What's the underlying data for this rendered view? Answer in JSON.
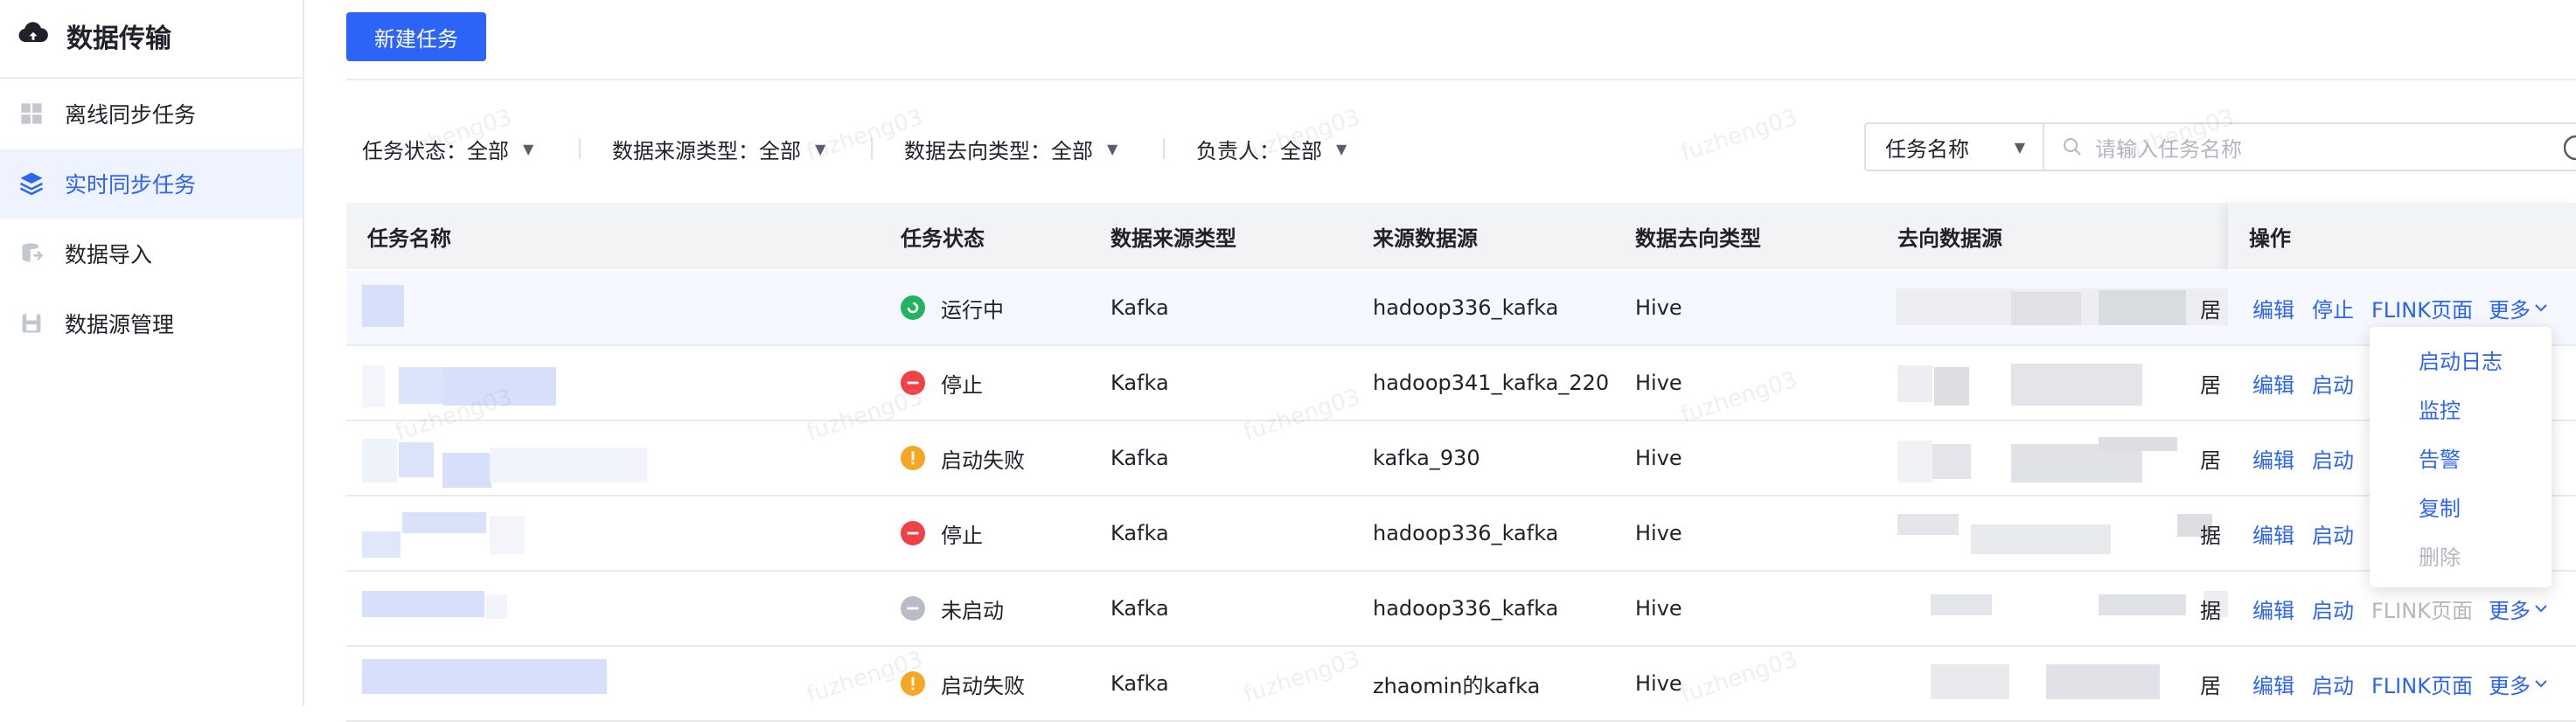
{
  "app": {
    "title": "数据传输"
  },
  "sidebar": {
    "items": [
      {
        "label": "离线同步任务",
        "icon": "grid-icon",
        "active": false
      },
      {
        "label": "实时同步任务",
        "icon": "layers-icon",
        "active": true
      },
      {
        "label": "数据导入",
        "icon": "database-import-icon",
        "active": false
      },
      {
        "label": "数据源管理",
        "icon": "datasource-icon",
        "active": false
      }
    ]
  },
  "toolbar": {
    "new_task_label": "新建任务"
  },
  "filters": [
    {
      "label": "任务状态：",
      "value": "全部"
    },
    {
      "label": "数据来源类型：",
      "value": "全部"
    },
    {
      "label": "数据去向类型：",
      "value": "全部"
    },
    {
      "label": "负责人：",
      "value": "全部"
    }
  ],
  "search": {
    "field_label": "任务名称",
    "placeholder": "请输入任务名称"
  },
  "table": {
    "columns": [
      "任务名称",
      "任务状态",
      "数据来源类型",
      "来源数据源",
      "数据去向类型",
      "去向数据源",
      "操作"
    ],
    "rows": [
      {
        "status": "运行中",
        "status_kind": "running",
        "source_type": "Kafka",
        "source": "hadoop336_kafka",
        "dest_type": "Hive",
        "dest_tail": "居",
        "op_toggle": "停止",
        "flink": "FLINK页面",
        "flink_disabled": false,
        "more": "更多"
      },
      {
        "status": "停止",
        "status_kind": "stopped",
        "source_type": "Kafka",
        "source": "hadoop341_kafka_220",
        "dest_type": "Hive",
        "dest_tail": "居",
        "op_toggle": "启动",
        "flink": "",
        "flink_disabled": false,
        "more": ""
      },
      {
        "status": "启动失败",
        "status_kind": "failed",
        "source_type": "Kafka",
        "source": "kafka_930",
        "dest_type": "Hive",
        "dest_tail": "居",
        "op_toggle": "启动",
        "flink": "",
        "flink_disabled": false,
        "more": ""
      },
      {
        "status": "停止",
        "status_kind": "stopped",
        "source_type": "Kafka",
        "source": "hadoop336_kafka",
        "dest_type": "Hive",
        "dest_tail": "据",
        "op_toggle": "启动",
        "flink": "",
        "flink_disabled": false,
        "more": ""
      },
      {
        "status": "未启动",
        "status_kind": "notstarted",
        "source_type": "Kafka",
        "source": "hadoop336_kafka",
        "dest_type": "Hive",
        "dest_tail": "据",
        "op_toggle": "启动",
        "flink": "FLINK页面",
        "flink_disabled": true,
        "more": "更多"
      },
      {
        "status": "启动失败",
        "status_kind": "failed",
        "source_type": "Kafka",
        "source": "zhaomin的kafka",
        "dest_type": "Hive",
        "dest_tail": "居",
        "op_toggle": "启动",
        "flink": "FLINK页面",
        "flink_disabled": false,
        "more": "更多"
      }
    ],
    "edit_label": "编辑"
  },
  "more_menu": {
    "items": [
      {
        "label": "启动日志",
        "disabled": false
      },
      {
        "label": "监控",
        "disabled": false
      },
      {
        "label": "告警",
        "disabled": false
      },
      {
        "label": "复制",
        "disabled": false
      },
      {
        "label": "删除",
        "disabled": true
      }
    ]
  },
  "watermark": "fuzheng03",
  "colors": {
    "primary": "#2b64f6",
    "running": "#22b35e",
    "stopped": "#f04245",
    "failed": "#f5a623",
    "notstarted": "#b8bcc4"
  }
}
